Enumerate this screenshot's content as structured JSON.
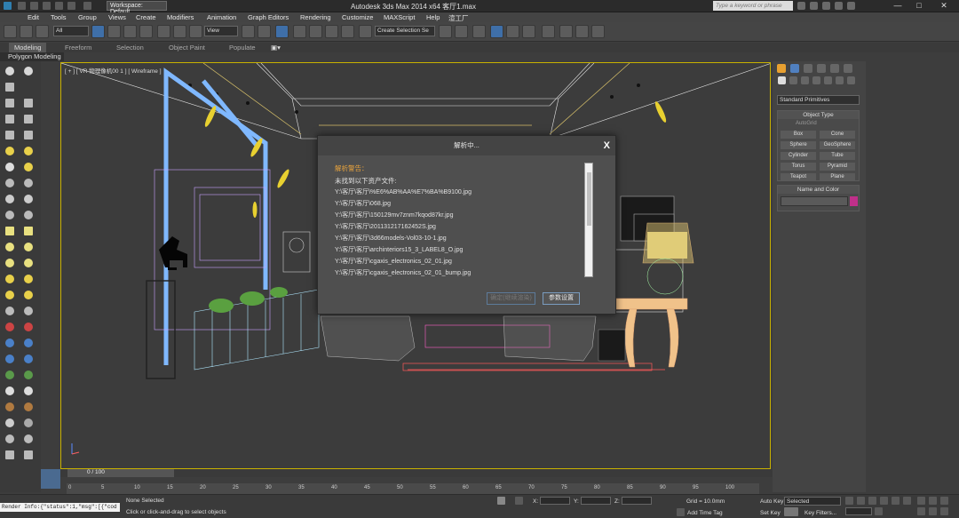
{
  "titlebar": {
    "workspace": "Workspace: Default",
    "title": "Autodesk 3ds Max  2014 x64     客厅1.max",
    "search_placeholder": "Type a keyword or phrase",
    "minimize": "—",
    "maximize": "□",
    "close": "✕"
  },
  "menu": [
    "Edit",
    "Tools",
    "Group",
    "Views",
    "Create",
    "Modifiers",
    "Animation",
    "Graph Editors",
    "Rendering",
    "Customize",
    "MAXScript",
    "Help",
    "渲工厂"
  ],
  "toolbar": {
    "selection_filter": "All",
    "ref_coord": "View",
    "named_selection": "Create Selection Se"
  },
  "ribbon": {
    "tabs": [
      "Modeling",
      "Freeform",
      "Selection",
      "Object Paint",
      "Populate"
    ],
    "active": "Modeling",
    "panel": "Polygon Modeling"
  },
  "viewport": {
    "label": "[ + ] [ VR 物理像机00 1 ] [ Wireframe ]"
  },
  "dialog": {
    "title": "解析中...",
    "close": "X",
    "warning": "解析警告：",
    "message": "未找到以下资产文件:",
    "files": [
      "Y:\\客厅\\客厅\\%E6%AB%AA%E7%BA%B9100.jpg",
      "Y:\\客厅\\客厅\\068.jpg",
      "Y:\\客厅\\客厅\\150129mv7znm7kqod87kr.jpg",
      "Y:\\客厅\\客厅\\201131217162452S.jpg",
      "Y:\\客厅\\客厅\\3d66models-Vol03-10-1.jpg",
      "Y:\\客厅\\客厅\\archinteriors15_3_LABEL8_O.jpg",
      "Y:\\客厅\\客厅\\cgaxis_electronics_02_01.jpg",
      "Y:\\客厅\\客厅\\cgaxis_electronics_02_01_bump.jpg"
    ],
    "btn_continue": "确定(继续渲染)",
    "btn_settings": "参数设置"
  },
  "cmdpanel": {
    "dropdown": "Standard Primitives",
    "object_type_header": "Object Type",
    "autogrid": "AutoGrid",
    "primitives": [
      "Box",
      "Cone",
      "Sphere",
      "GeoSphere",
      "Cylinder",
      "Tube",
      "Torus",
      "Pyramid",
      "Teapot",
      "Plane"
    ],
    "name_color_header": "Name and Color",
    "object_color": "#c0308a"
  },
  "timeline": {
    "frame": "0 / 100",
    "ticks": [
      "0",
      "5",
      "10",
      "15",
      "20",
      "25",
      "30",
      "35",
      "40",
      "45",
      "50",
      "55",
      "60",
      "65",
      "70",
      "75",
      "80",
      "85",
      "90",
      "95",
      "100"
    ]
  },
  "status": {
    "maxscript": "Render Info:{\"status\":1,\"msg\":[{\"cod",
    "selected": "None Selected",
    "prompt": "Click or click-and-drag to select objects",
    "x_label": "X:",
    "y_label": "Y:",
    "z_label": "Z:",
    "grid": "Grid = 10.0mm",
    "add_time_tag": "Add Time Tag",
    "auto_key": "Auto Key",
    "set_key": "Set Key",
    "selected_dd": "Selected",
    "key_filters": "Key Filters..."
  },
  "colors": {
    "viewport_border": "#c8b100",
    "warning": "#e8a33d",
    "accent_blue": "#3f6fa8"
  }
}
